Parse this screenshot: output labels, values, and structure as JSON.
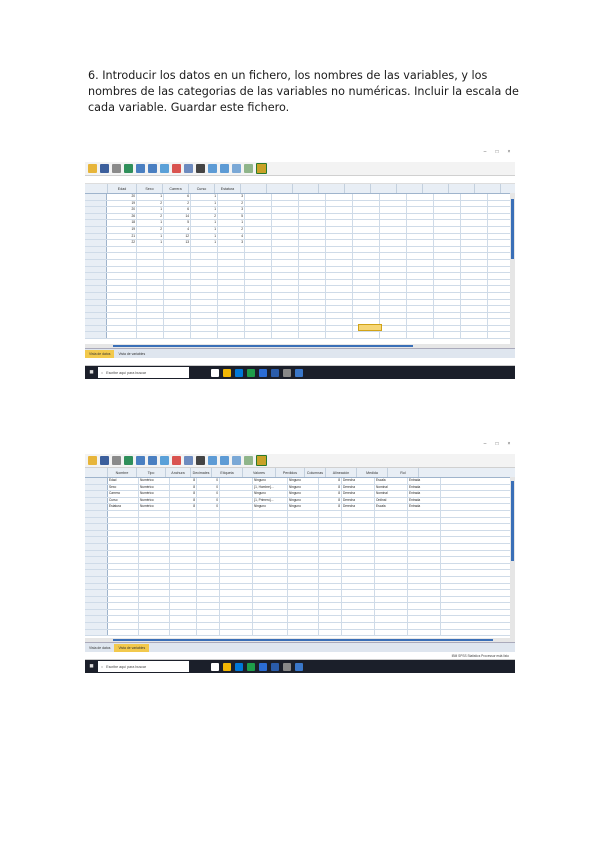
{
  "instruction": {
    "line1": "6. Introducir los datos en un fichero, los nombres de las variables, y los",
    "line2": "nombres de las categorias de las variables no numéricas. Incluir la escala de",
    "line3": "cada variable. Guardar este fichero."
  },
  "shot1": {
    "tabs": [
      "Vista de datos",
      "Vista de variables"
    ],
    "search_placeholder": "Escribe aquí para buscar",
    "columns": [
      "Edad",
      "Sexo",
      "Carrera",
      "Curso",
      "Estatura"
    ],
    "rows": [
      [
        "20",
        "1",
        "6",
        "1",
        "3"
      ],
      [
        "19",
        "2",
        "2",
        "1",
        "2"
      ],
      [
        "20",
        "1",
        "6",
        "1",
        "3"
      ],
      [
        "26",
        "2",
        "14",
        "2",
        "5"
      ],
      [
        "18",
        "1",
        "5",
        "1",
        "1"
      ],
      [
        "19",
        "2",
        "4",
        "1",
        "2"
      ],
      [
        "21",
        "1",
        "12",
        "1",
        "4"
      ],
      [
        "22",
        "1",
        "13",
        "1",
        "3"
      ]
    ]
  },
  "shot2": {
    "tabs": [
      "Vista de datos",
      "Vista de variables"
    ],
    "search_placeholder": "Escribe aquí para buscar",
    "status": "IBM SPSS Statistics Processor está listo",
    "columns": [
      "Nombre",
      "Tipo",
      "Anchura",
      "Decimales",
      "Etiqueta",
      "Valores",
      "Perdidos",
      "Columnas",
      "Alineación",
      "Medida",
      "Rol"
    ],
    "rows": [
      [
        "Edad",
        "Numérico",
        "8",
        "0",
        "",
        "Ninguno",
        "Ninguno",
        "8",
        "Derecha",
        "Escala",
        "Entrada"
      ],
      [
        "Sexo",
        "Numérico",
        "8",
        "0",
        "",
        "{1, Hombre}...",
        "Ninguno",
        "8",
        "Derecha",
        "Nominal",
        "Entrada"
      ],
      [
        "Carrera",
        "Numérico",
        "8",
        "0",
        "",
        "Ninguno",
        "Ninguno",
        "8",
        "Derecha",
        "Nominal",
        "Entrada"
      ],
      [
        "Curso",
        "Numérico",
        "8",
        "0",
        "",
        "{1, Primero}...",
        "Ninguno",
        "8",
        "Derecha",
        "Ordinal",
        "Entrada"
      ],
      [
        "Estatura",
        "Numérico",
        "8",
        "0",
        "",
        "Ninguno",
        "Ninguno",
        "8",
        "Derecha",
        "Escala",
        "Entrada"
      ]
    ]
  }
}
